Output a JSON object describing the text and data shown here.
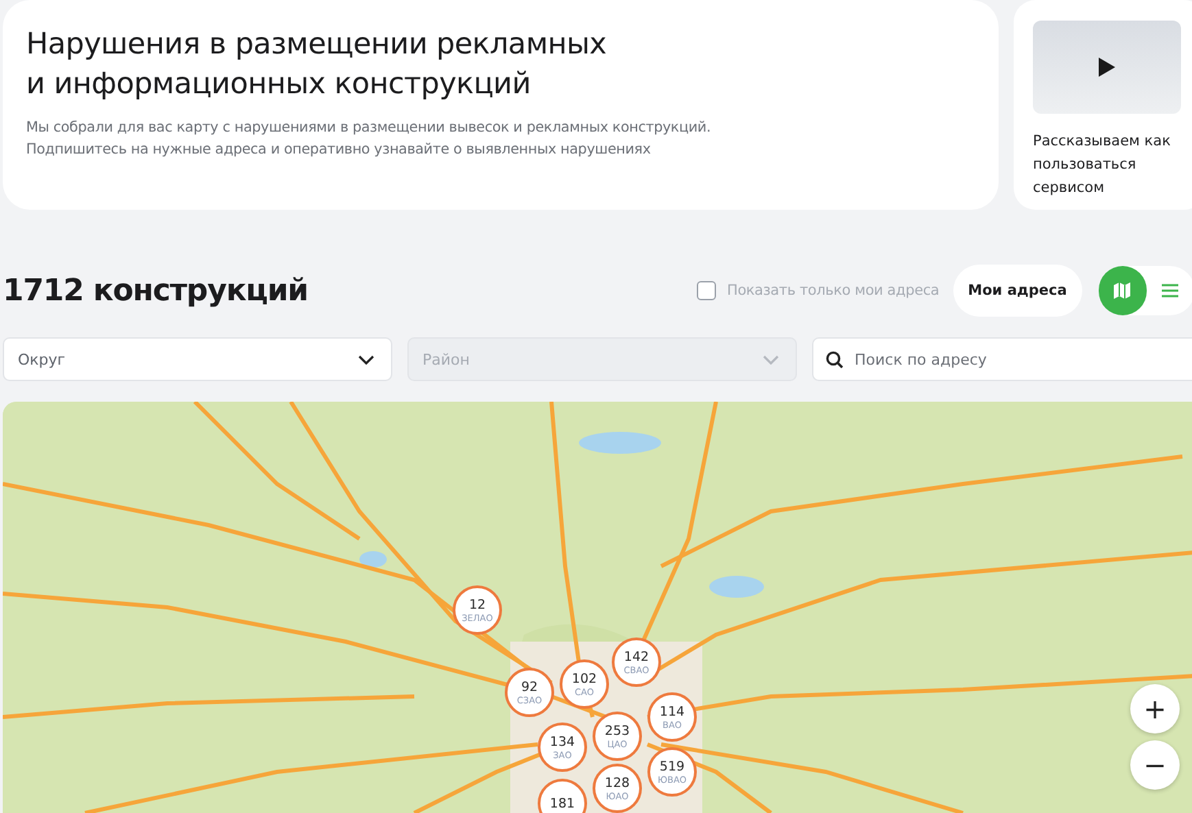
{
  "intro": {
    "title": "Нарушения в размещении рекламных\nи информационных конструкций",
    "description": "Мы собрали для вас карту с нарушениями в размещении вывесок и рекламных конструкций.\nПодпишитесь на нужные адреса и оперативно узнавайте о выявленных нарушениях"
  },
  "video_card": {
    "caption": "Рассказываем как пользоваться сервисом"
  },
  "count_title": "1712 конструкций",
  "only_mine": {
    "label": "Показать только мои адреса",
    "checked": false
  },
  "my_addresses_button": "Мои адреса",
  "view_toggle": [
    {
      "kind": "map",
      "selected": true
    },
    {
      "kind": "list",
      "selected": false
    }
  ],
  "filters": [
    {
      "kind": "select",
      "placeholder": "Округ",
      "disabled": false
    },
    {
      "kind": "select",
      "placeholder": "Район",
      "disabled": true
    },
    {
      "kind": "search",
      "placeholder": "Поиск по адресу"
    }
  ],
  "map": {
    "clusters": [
      {
        "count": "12",
        "district": "ЗЕЛАО"
      },
      {
        "count": "92",
        "district": "СЗАО"
      },
      {
        "count": "102",
        "district": "САО"
      },
      {
        "count": "142",
        "district": "СВАО"
      },
      {
        "count": "114",
        "district": "ВАО"
      },
      {
        "count": "253",
        "district": "ЦАО"
      },
      {
        "count": "134",
        "district": "ЗАО"
      },
      {
        "count": "519",
        "district": "ЮВАО"
      },
      {
        "count": "128",
        "district": "ЮАО"
      },
      {
        "count": "181"
      }
    ],
    "zoom_controls": [
      "+",
      "−"
    ]
  }
}
